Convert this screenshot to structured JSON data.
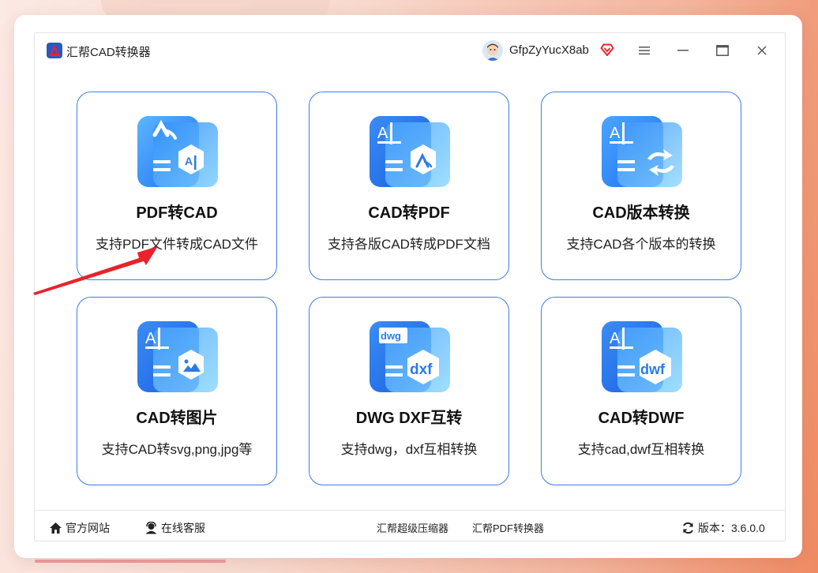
{
  "app": {
    "title": "汇帮CAD转换器"
  },
  "user": {
    "name": "GfpZyYucX8ab"
  },
  "cards": [
    {
      "title": "PDF转CAD",
      "desc": "支持PDF文件转成CAD文件"
    },
    {
      "title": "CAD转PDF",
      "desc": "支持各版CAD转成PDF文档"
    },
    {
      "title": "CAD版本转换",
      "desc": "支持CAD各个版本的转换"
    },
    {
      "title": "CAD转图片",
      "desc": "支持CAD转svg,png,jpg等"
    },
    {
      "title": "DWG DXF互转",
      "desc": "支持dwg，dxf互相转换"
    },
    {
      "title": "CAD转DWF",
      "desc": "支持cad,dwf互相转换"
    }
  ],
  "icon_labels": {
    "dwg": "dwg",
    "dxf": "dxf",
    "dwf": "dwf"
  },
  "footer": {
    "website": "官方网站",
    "service": "在线客服",
    "compressor": "汇帮超级压缩器",
    "pdf_converter": "汇帮PDF转换器",
    "version": "版本：3.6.0.0"
  },
  "colors": {
    "accent": "#3c7bea",
    "annotation_arrow": "#e8232a"
  }
}
